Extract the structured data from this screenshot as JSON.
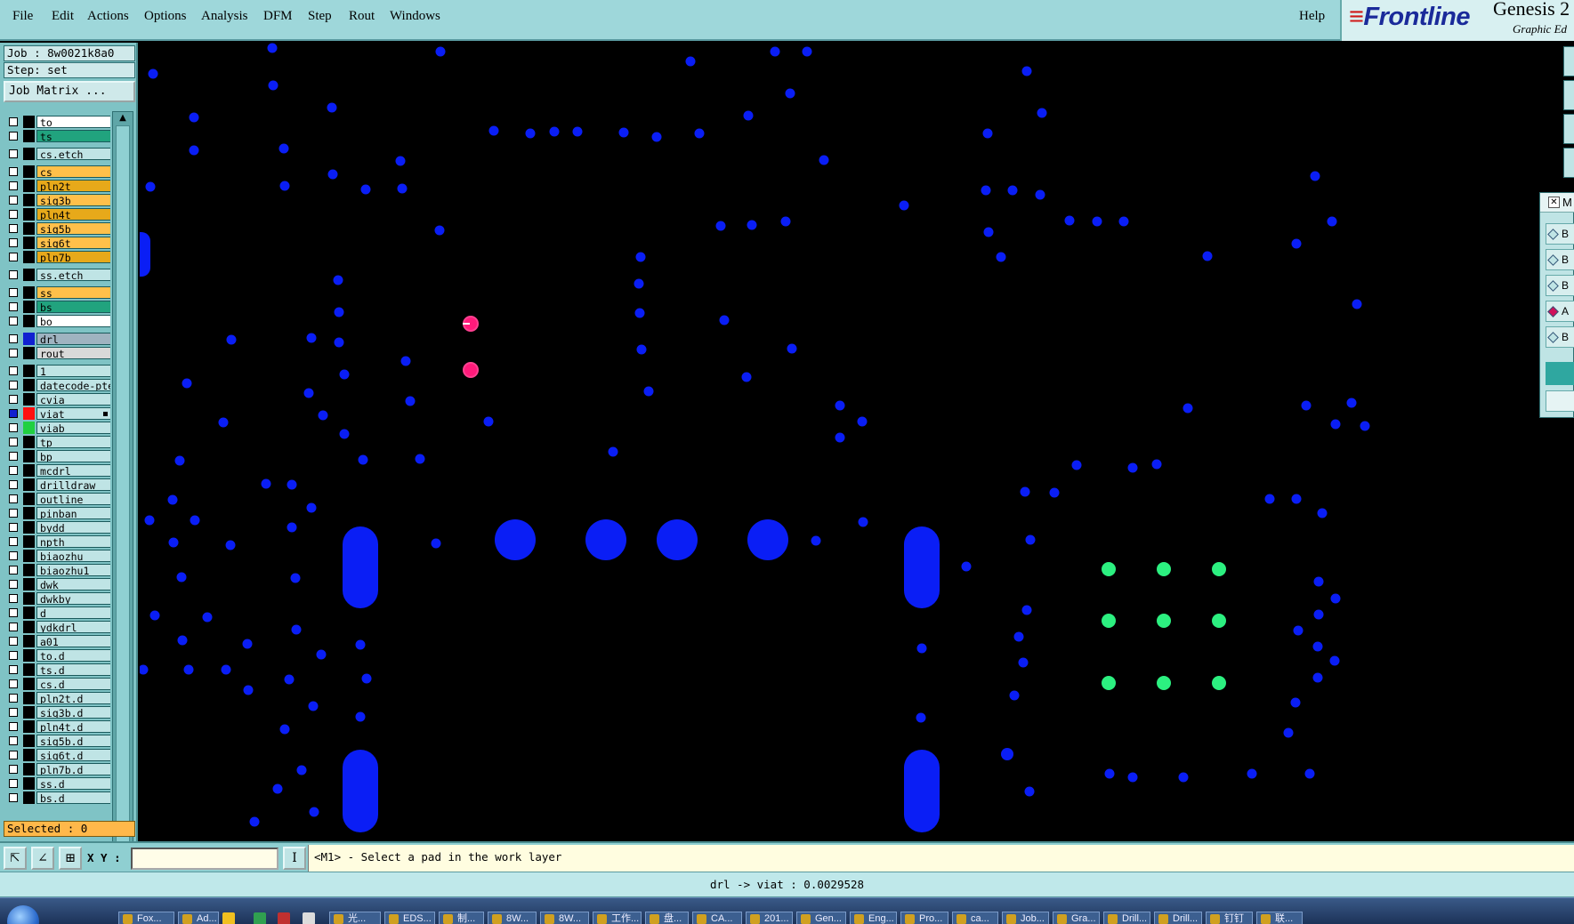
{
  "menu": {
    "items": [
      "File",
      "Edit",
      "Actions",
      "Options",
      "Analysis",
      "DFM",
      "Step",
      "Rout",
      "Windows"
    ],
    "help": "Help"
  },
  "brand": {
    "logo_main": "Frontline",
    "title": "Genesis 2",
    "subtitle": "Graphic Ed"
  },
  "job": {
    "job_label": "Job : 8w0021k8a0",
    "step_label": "Step: set",
    "job_matrix_button": "Job Matrix ..."
  },
  "layers": [
    {
      "name": "to",
      "color": "#ffffff",
      "sw": "#000000"
    },
    {
      "name": "ts",
      "color": "#21a37e",
      "sw": "#000000"
    },
    {
      "name": "cs.etch",
      "color": "#bfe4e5",
      "sw": "#000000",
      "gap": true
    },
    {
      "name": "cs",
      "color": "#ffc04a",
      "sw": "#000000",
      "gap": true
    },
    {
      "name": "pln2t",
      "color": "#e7a91a",
      "sw": "#000000"
    },
    {
      "name": "sig3b",
      "color": "#ffc04a",
      "sw": "#000000"
    },
    {
      "name": "pln4t",
      "color": "#e7a91a",
      "sw": "#000000"
    },
    {
      "name": "sig5b",
      "color": "#ffc04a",
      "sw": "#000000"
    },
    {
      "name": "sig6t",
      "color": "#ffc04a",
      "sw": "#000000"
    },
    {
      "name": "pln7b",
      "color": "#e7a91a",
      "sw": "#000000"
    },
    {
      "name": "ss.etch",
      "color": "#bfe4e5",
      "sw": "#000000",
      "gap": true
    },
    {
      "name": "ss",
      "color": "#ffc04a",
      "sw": "#000000",
      "gap": true
    },
    {
      "name": "bs",
      "color": "#21a37e",
      "sw": "#000000"
    },
    {
      "name": "bo",
      "color": "#ffffff",
      "sw": "#000000"
    },
    {
      "name": "drl",
      "color": "#9fb3c0",
      "sw": "#1020d0",
      "gap": true
    },
    {
      "name": "rout",
      "color": "#d9d9d9",
      "sw": "#000000"
    },
    {
      "name": "1",
      "color": "#bfe4e5",
      "sw": "#000000",
      "gap": true
    },
    {
      "name": "datecode-pte",
      "color": "#bfe4e5",
      "sw": "#000000"
    },
    {
      "name": "cvia",
      "color": "#bfe4e5",
      "sw": "#000000"
    },
    {
      "name": "viat",
      "color": "#bfe4e5",
      "sw": "#ff1010",
      "work": true
    },
    {
      "name": "viab",
      "color": "#bfe4e5",
      "sw": "#20d040"
    },
    {
      "name": "tp",
      "color": "#bfe4e5",
      "sw": "#000000"
    },
    {
      "name": "bp",
      "color": "#bfe4e5",
      "sw": "#000000"
    },
    {
      "name": "mcdrl",
      "color": "#bfe4e5",
      "sw": "#000000"
    },
    {
      "name": "drilldraw",
      "color": "#bfe4e5",
      "sw": "#000000"
    },
    {
      "name": "outline",
      "color": "#bfe4e5",
      "sw": "#000000"
    },
    {
      "name": "pinban",
      "color": "#bfe4e5",
      "sw": "#000000"
    },
    {
      "name": "bydd",
      "color": "#bfe4e5",
      "sw": "#000000"
    },
    {
      "name": "npth",
      "color": "#bfe4e5",
      "sw": "#000000"
    },
    {
      "name": "biaozhu",
      "color": "#bfe4e5",
      "sw": "#000000"
    },
    {
      "name": "biaozhu1",
      "color": "#bfe4e5",
      "sw": "#000000"
    },
    {
      "name": "dwk",
      "color": "#bfe4e5",
      "sw": "#000000"
    },
    {
      "name": "dwkby",
      "color": "#bfe4e5",
      "sw": "#000000"
    },
    {
      "name": "d",
      "color": "#bfe4e5",
      "sw": "#000000"
    },
    {
      "name": "ydkdrl",
      "color": "#bfe4e5",
      "sw": "#000000"
    },
    {
      "name": "a01",
      "color": "#bfe4e5",
      "sw": "#000000"
    },
    {
      "name": "to.d",
      "color": "#bfe4e5",
      "sw": "#000000"
    },
    {
      "name": "ts.d",
      "color": "#bfe4e5",
      "sw": "#000000"
    },
    {
      "name": "cs.d",
      "color": "#bfe4e5",
      "sw": "#000000"
    },
    {
      "name": "pln2t.d",
      "color": "#bfe4e5",
      "sw": "#000000"
    },
    {
      "name": "sig3b.d",
      "color": "#bfe4e5",
      "sw": "#000000"
    },
    {
      "name": "pln4t.d",
      "color": "#bfe4e5",
      "sw": "#000000"
    },
    {
      "name": "sig5b.d",
      "color": "#bfe4e5",
      "sw": "#000000"
    },
    {
      "name": "sig6t.d",
      "color": "#bfe4e5",
      "sw": "#000000"
    },
    {
      "name": "pln7b.d",
      "color": "#bfe4e5",
      "sw": "#000000"
    },
    {
      "name": "ss.d",
      "color": "#bfe4e5",
      "sw": "#000000"
    },
    {
      "name": "bs.d",
      "color": "#bfe4e5",
      "sw": "#000000"
    }
  ],
  "selected_label": "Selected : 0",
  "toolbar": {
    "xy_label": "X Y :",
    "xy_value": "",
    "prompt": "<M1> - Select a pad in the work layer"
  },
  "status": "drl -> viat : 0.0029528",
  "side_dialog": {
    "title": "M",
    "items": [
      "B",
      "B",
      "B",
      "A",
      "B"
    ]
  },
  "colors": {
    "drill_pad": "#0a1ef5",
    "viat_pad": "#ff1a7a",
    "viab_pad": "#2cf080",
    "canvas_bg": "#000000"
  },
  "taskbar": {
    "items": [
      "Fox...",
      "Ad...",
      "",
      "",
      "",
      "",
      "光...",
      "EDS...",
      "制...",
      "8W...",
      "8W...",
      "工作...",
      "盘...",
      "CA...",
      "201...",
      "Gen...",
      "Eng...",
      "Pro...",
      "ca...",
      "Job...",
      "Gra...",
      "Drill...",
      "Drill...",
      "钉钉",
      "联..."
    ]
  }
}
